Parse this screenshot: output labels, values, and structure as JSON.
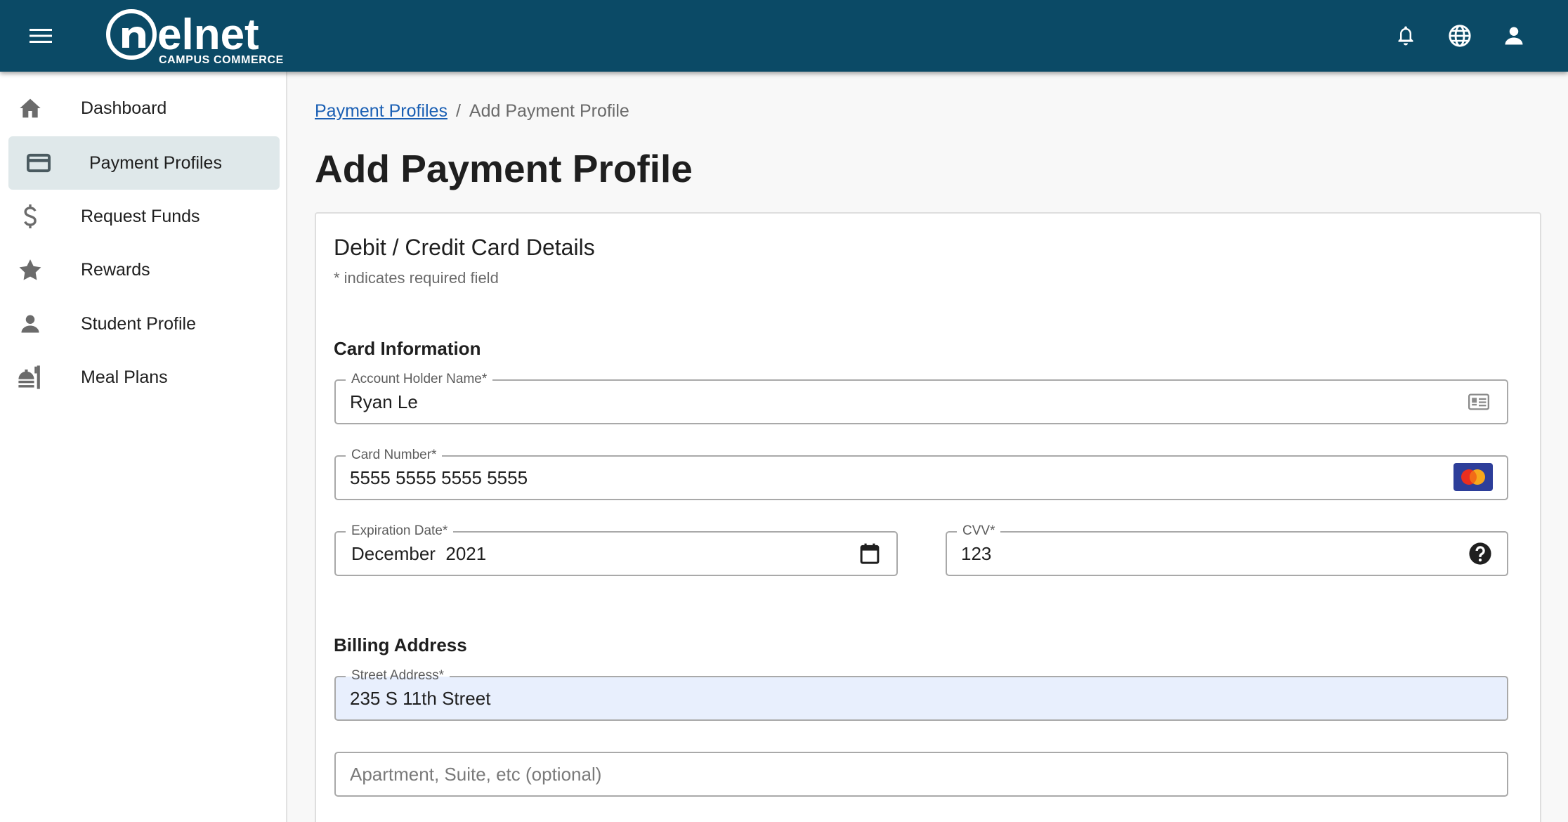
{
  "header": {
    "logo_text": "nelnet",
    "logo_subtext": "CAMPUS COMMERCE",
    "icons": [
      "menu-icon",
      "bell-icon",
      "globe-icon",
      "account-icon"
    ],
    "background_color": "#0b4a66"
  },
  "sidebar": {
    "items": [
      {
        "label": "Dashboard",
        "icon": "home-icon",
        "active": false
      },
      {
        "label": "Payment Profiles",
        "icon": "credit-card-icon",
        "active": true
      },
      {
        "label": "Request Funds",
        "icon": "dollar-icon",
        "active": false
      },
      {
        "label": "Rewards",
        "icon": "star-icon",
        "active": false
      },
      {
        "label": "Student Profile",
        "icon": "person-icon",
        "active": false
      },
      {
        "label": "Meal Plans",
        "icon": "meal-icon",
        "active": false
      }
    ]
  },
  "breadcrumb": {
    "parent": "Payment Profiles",
    "separator": "/",
    "current": "Add Payment Profile"
  },
  "page": {
    "title": "Add Payment Profile"
  },
  "form": {
    "title": "Debit / Credit Card Details",
    "required_note": "* indicates required field",
    "card_section_title": "Card Information",
    "billing_section_title": "Billing Address",
    "fields": {
      "account_holder": {
        "label": "Account Holder Name",
        "required_mark": "*",
        "value": "Ryan Le",
        "icon": "contact-card-icon"
      },
      "card_number": {
        "label": "Card Number",
        "required_mark": "*",
        "value": "5555 5555 5555 5555",
        "icon": "mastercard-icon"
      },
      "expiration": {
        "label": "Expiration Date",
        "required_mark": "*",
        "value": "December  2021",
        "icon": "calendar-icon"
      },
      "cvv": {
        "label": "CVV",
        "required_mark": "*",
        "value": "123",
        "icon": "help-icon"
      },
      "street": {
        "label": "Street Address",
        "required_mark": "*",
        "value": "235 S 11th Street"
      },
      "apartment": {
        "placeholder": "Apartment, Suite, etc (optional)",
        "value": ""
      }
    }
  }
}
